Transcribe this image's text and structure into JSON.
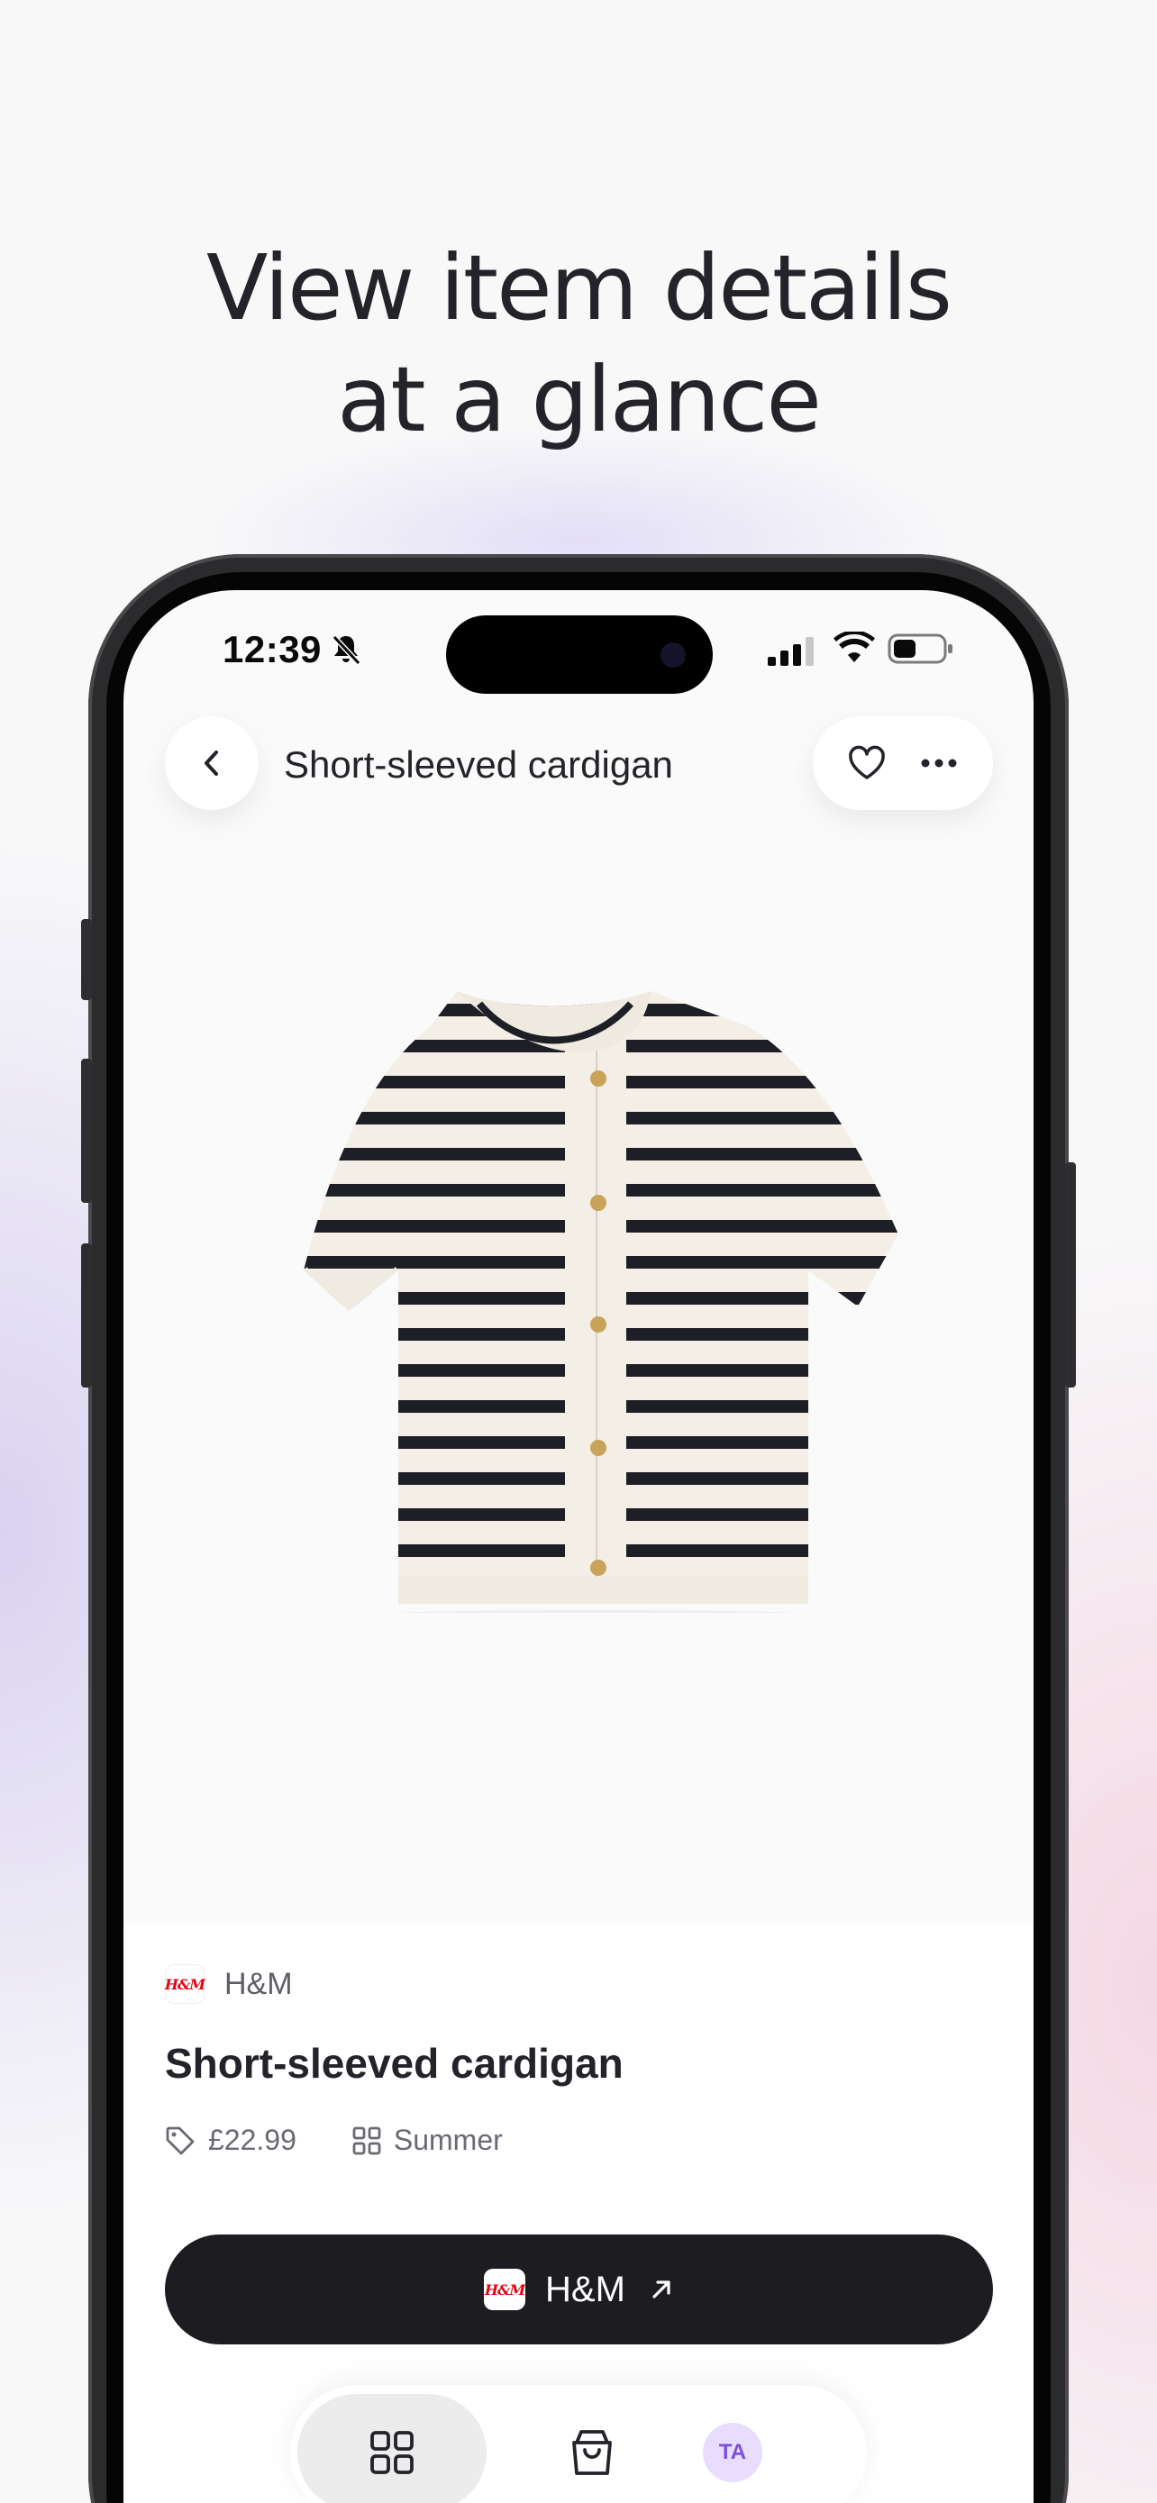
{
  "headline": {
    "line1": "View item details",
    "line2": "at a glance"
  },
  "status_bar": {
    "time": "12:39",
    "icons": [
      "bell-slash-icon",
      "cellular-signal-icon",
      "wifi-icon",
      "battery-icon"
    ]
  },
  "nav": {
    "title": "Short-sleeved cardigan",
    "back_icon": "chevron-left-icon",
    "actions": [
      "heart-icon",
      "more-horizontal-icon"
    ]
  },
  "product": {
    "image": "striped-short-sleeved-cardigan",
    "brand": "H&M",
    "brand_logo_text": "H&M",
    "title": "Short-sleeved cardigan",
    "price": "£22.99",
    "collection": "Summer"
  },
  "shop_button": {
    "label": "H&M",
    "icon": "arrow-up-right-icon"
  },
  "tab_bar": {
    "items": [
      "grid-icon",
      "shopping-bag-icon",
      "avatar"
    ],
    "active": "grid-icon",
    "avatar_initials": "TA"
  },
  "colors": {
    "accent_dark": "#1d1d21",
    "brand_red": "#e50010",
    "avatar_bg": "#e8ddfd",
    "avatar_fg": "#7b4fd6"
  }
}
